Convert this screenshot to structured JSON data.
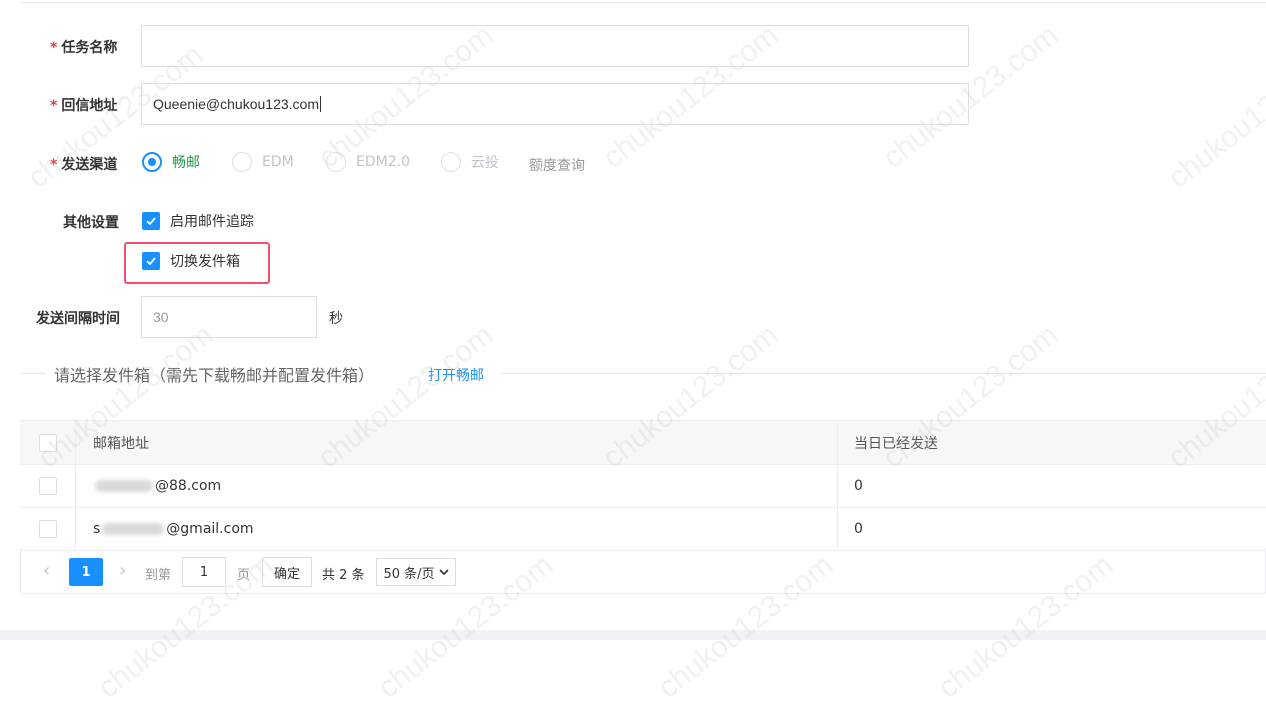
{
  "form": {
    "task_name": {
      "required_mark": "*",
      "label": "任务名称",
      "value": ""
    },
    "reply_address": {
      "required_mark": "*",
      "label": "回信地址",
      "value": "Queenie@chukou123.com"
    },
    "send_channel": {
      "required_mark": "*",
      "label": "发送渠道",
      "options": [
        "畅邮",
        "EDM",
        "EDM2.0",
        "云投"
      ],
      "selected": "畅邮",
      "quota_link": "额度查询"
    },
    "other_settings": {
      "label": "其他设置",
      "enable_tracking": "启用邮件追踪",
      "switch_sender": "切换发件箱"
    },
    "interval": {
      "label": "发送间隔时间",
      "value": "30",
      "unit": "秒"
    }
  },
  "section": {
    "title": "请选择发件箱（需先下载畅邮并配置发件箱）",
    "link": "打开畅邮"
  },
  "table": {
    "columns": [
      "邮箱地址",
      "当日已经发送"
    ],
    "rows": [
      {
        "email_visible": "@88.com",
        "sent": "0"
      },
      {
        "email_prefix": "s",
        "email_visible": "@gmail.com",
        "sent": "0"
      }
    ]
  },
  "pagination": {
    "prev": "‹",
    "current": "1",
    "next": "›",
    "goto_label": "到第",
    "goto_value": "1",
    "page_unit": "页",
    "confirm": "确定",
    "total": "共 2 条",
    "page_size": "50 条/页"
  },
  "watermark": "chukou123.com",
  "colors": {
    "primary": "#1890ff",
    "required": "#e4393c",
    "highlight": "#f0506e",
    "selected_text": "#1e9a45"
  }
}
